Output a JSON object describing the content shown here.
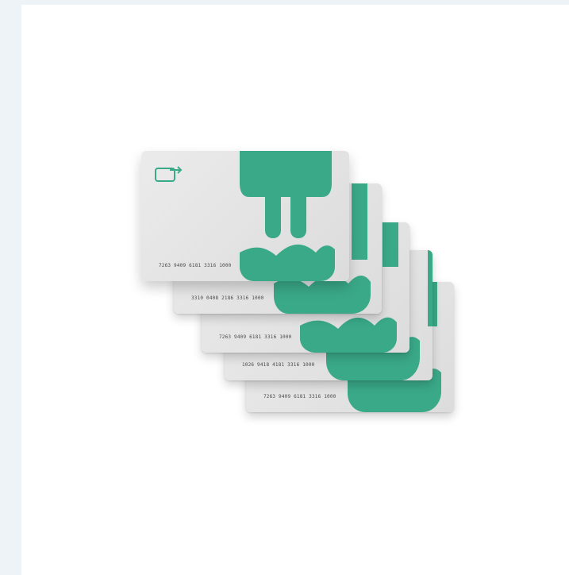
{
  "image": {
    "subject": "stack of five charging cards",
    "brand_color": "#3aa988",
    "card_color": "#e6e6e6",
    "background": "#eef3f7",
    "panel_background": "#ffffff",
    "icon": "contactless-card-icon"
  },
  "cards": [
    {
      "number": "7263 9409 6181 3316 1000"
    },
    {
      "number": "3310 0408 2186 3316 1000"
    },
    {
      "number": "7263 9409 6181 3316 1000"
    },
    {
      "number": "1026 9418 4181 3316 1000"
    },
    {
      "number": "7263 9409 6181 3316 1000"
    }
  ]
}
